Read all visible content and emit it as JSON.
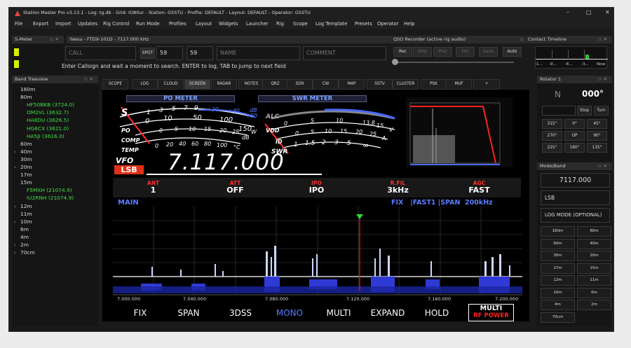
{
  "window": {
    "title": "Station Master Pro v3.13.1  -  Log: tg.db  -  Grid: IO80ur  -  Station: G5STU  -  Profile: DEFAULT  -  Layout: DEFAULT  -  Operator: G5STU",
    "controls": [
      "–",
      "□",
      "✕"
    ]
  },
  "menu": [
    "File",
    "Export",
    "Import",
    "Updates",
    "Rig Control",
    "Run Mode",
    "Profiles",
    "Layout",
    "Widgets",
    "Launcher",
    "Rig",
    "Scope",
    "Log Template",
    "Presets",
    "Operator",
    "Help"
  ],
  "panels": {
    "smeter": "S-Meter",
    "rig": "Yaesu - FTDX-101D - 7117.000 kHz",
    "qso": "QSO Recorder (active rig audio)",
    "contact": "Contact Timeline",
    "band": "Band Treeview",
    "rotator": "Rotator 1",
    "modeband": "Mode/Band"
  },
  "entry": {
    "call_placeholder": "CALL",
    "spot_label": "SPOT",
    "rst_sent": "59",
    "rst_rcvd": "59",
    "name_placeholder": "NAME",
    "comment_placeholder": "COMMENT",
    "hint": "Enter Callsign and wait a moment to search. ENTER to log, TAB to jump to next field"
  },
  "recorder": [
    "Rec",
    "Stop",
    "Play",
    "Del",
    "Save",
    "Auto"
  ],
  "timeline": [
    "-1...",
    "-9...",
    "-6...",
    "-3...",
    "Now"
  ],
  "bands": [
    {
      "label": "160m",
      "type": "band"
    },
    {
      "label": "80m",
      "type": "band"
    },
    {
      "label": "HF50BKB (3724.0)",
      "type": "spot"
    },
    {
      "label": "OM2VL (3632.7)",
      "type": "spot"
    },
    {
      "label": "HA8DU (3626.5)",
      "type": "spot"
    },
    {
      "label": "HG8CX (3621.0)",
      "type": "spot"
    },
    {
      "label": "HA5JI (3616.0)",
      "type": "spot"
    },
    {
      "label": "60m",
      "type": "band"
    },
    {
      "label": "40m",
      "type": "band",
      "arrow": true
    },
    {
      "label": "30m",
      "type": "band"
    },
    {
      "label": "20m",
      "type": "band",
      "arrow": true
    },
    {
      "label": "17m",
      "type": "band"
    },
    {
      "label": "15m",
      "type": "band"
    },
    {
      "label": "F5MXH (21074.9)",
      "type": "spot"
    },
    {
      "label": "IU2RNH (21074.9)",
      "type": "spot"
    },
    {
      "label": "12m",
      "type": "band",
      "arrow": true
    },
    {
      "label": "11m",
      "type": "band"
    },
    {
      "label": "10m",
      "type": "band",
      "arrow": true
    },
    {
      "label": "6m",
      "type": "band"
    },
    {
      "label": "4m",
      "type": "band"
    },
    {
      "label": "2m",
      "type": "band",
      "arrow": true
    },
    {
      "label": "70cm",
      "type": "band",
      "arrow": true
    }
  ],
  "tabs": [
    "SCOPE",
    "LOG",
    "CLOUD",
    "SCREEN",
    "RADAR",
    "NOTES",
    "QRZ",
    "SDR",
    "CW",
    "MAP",
    "SSTV",
    "CLUSTER",
    "PSK",
    "MUF",
    "+"
  ],
  "radio": {
    "po_meter": "PO METER",
    "swr_meter": "SWR METER",
    "vfo_label": "VFO",
    "mode": "LSB",
    "frequency": "7.117.000",
    "meter": {
      "s_scale": [
        "S",
        "1",
        "3",
        "5",
        "7",
        "9",
        "+20",
        "+40",
        "+60",
        "dB"
      ],
      "po_scale": [
        "PO",
        "0",
        "10",
        "50",
        "100",
        "150",
        "W"
      ],
      "comp_scale": [
        "COMP",
        "0",
        "5",
        "10",
        "15",
        "20",
        "25",
        "dB"
      ],
      "temp_scale": [
        "TEMP",
        "0",
        "20",
        "40",
        "60",
        "80",
        "100",
        "°C"
      ],
      "alc_label": "ALC",
      "vdd_scale": [
        "VDD",
        "0",
        "5",
        "10",
        "13.8",
        "15",
        "V"
      ],
      "id_scale": [
        "ID",
        "0",
        "5",
        "10",
        "15",
        "20",
        "25",
        "A"
      ],
      "swr_scale": [
        "SWR",
        "1",
        "1.5",
        "2",
        "3",
        "5",
        "∞"
      ]
    },
    "status": [
      {
        "key": "ANT",
        "value": "1"
      },
      {
        "key": "ATT",
        "value": "OFF"
      },
      {
        "key": "IPO",
        "value": "IPO"
      },
      {
        "key": "R.FIL",
        "value": "3kHz"
      },
      {
        "key": "AGC",
        "value": "FAST"
      }
    ],
    "scope_label": "MAIN",
    "scope_info": "FIX   |FAST1 |SPAN  200kHz",
    "freq_ticks": [
      "7.000.000",
      "7.040.000",
      "7.080.000",
      "7.120.000",
      "7.160.000",
      "7.200.000"
    ],
    "modes": [
      "FIX",
      "SPAN",
      "3DSS",
      "MONO",
      "MULTI",
      "EXPAND",
      "HOLD"
    ],
    "multi_top": "MULTI",
    "multi_bottom": "RF POWER",
    "colors": {
      "accent": "#5a7cff",
      "alert": "#ff2020",
      "scope_line": "#ffffff"
    }
  },
  "rotator": {
    "dir": "N",
    "deg": "000°",
    "stop": "Stop",
    "turn": "Turn",
    "presets": [
      "315°",
      "0°",
      "45°",
      "270°",
      "OP",
      "90°",
      "225°",
      "180°",
      "135°"
    ]
  },
  "modeband": {
    "freq": "7117.000",
    "mode": "LSB",
    "log_mode": "LOG MODE (OPTIONAL)",
    "bands": [
      "160m",
      "80m",
      "60m",
      "40m",
      "30m",
      "20m",
      "17m",
      "15m",
      "12m",
      "11m",
      "10m",
      "6m",
      "4m",
      "2m",
      "70cm"
    ]
  }
}
